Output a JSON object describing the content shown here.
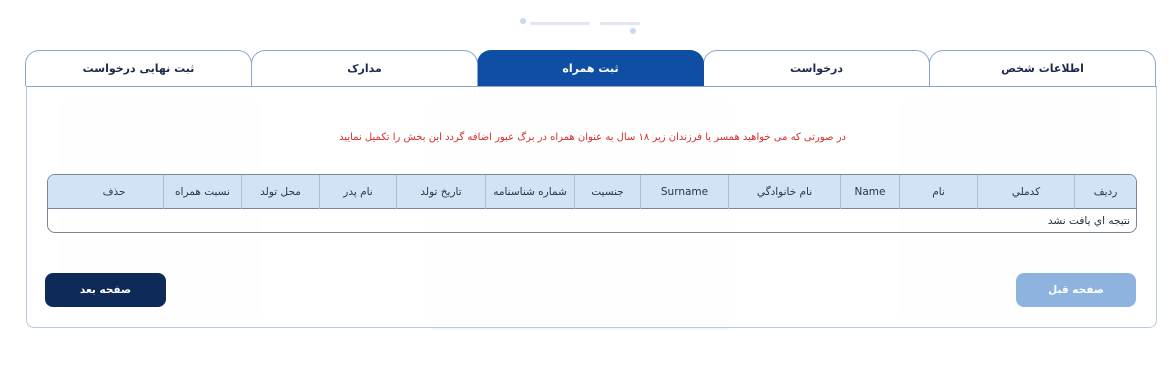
{
  "tabs": [
    {
      "label": "اطلاعات شخص",
      "active": false
    },
    {
      "label": "درخواست",
      "active": false
    },
    {
      "label": "ثبت همراه",
      "active": true
    },
    {
      "label": "مدارک",
      "active": false
    },
    {
      "label": "ثبت نهایی درخواست",
      "active": false
    }
  ],
  "notice": "در صورتی که می خواهید همسر یا فرزندان زیر ۱۸ سال به عنوان همراه در برگ عبور اضافه گردد این بخش را تکمیل نمایید",
  "table": {
    "columns": [
      "ردیف",
      "کدملي",
      "نام",
      "Name",
      "نام خانوادگي",
      "Surname",
      "جنسيت",
      "شماره شناسنامه",
      "تاريخ تولد",
      "نام پدر",
      "محل تولد",
      "نسبت همراه",
      "حذف"
    ],
    "empty_message": "نتيجه اي يافت نشد"
  },
  "buttons": {
    "prev": "صفحه قبل",
    "next": "صفحه بعد"
  },
  "colors": {
    "active_tab": "#0e4fa3",
    "header_bg": "#d2e3f5",
    "notice": "#d92b2b",
    "next_btn": "#0d2a59",
    "prev_btn": "#8fb3df"
  }
}
